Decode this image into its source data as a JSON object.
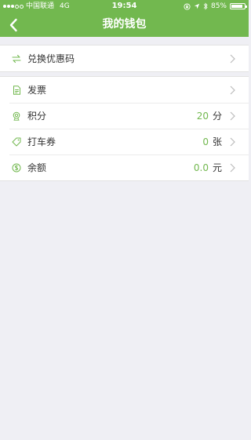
{
  "statusbar": {
    "carrier": "中国联通",
    "network": "4G",
    "time": "19:54",
    "battery": "85%",
    "battery_level": 0.85
  },
  "navbar": {
    "title": "我的钱包"
  },
  "coupon_group": {
    "items": [
      {
        "label": "兑换优惠码",
        "icon": "swap-arrows-icon"
      }
    ]
  },
  "wallet_group": {
    "items": [
      {
        "label": "发票",
        "icon": "document-icon"
      },
      {
        "label": "积分",
        "icon": "medal-icon",
        "value": "20",
        "unit": "分"
      },
      {
        "label": "打车券",
        "icon": "tag-icon",
        "value": "0",
        "unit": "张"
      },
      {
        "label": "余额",
        "icon": "coin-icon",
        "value": "0.0",
        "unit": "元"
      }
    ]
  },
  "colors": {
    "accent": "#72b84f",
    "background": "#efeff4"
  }
}
